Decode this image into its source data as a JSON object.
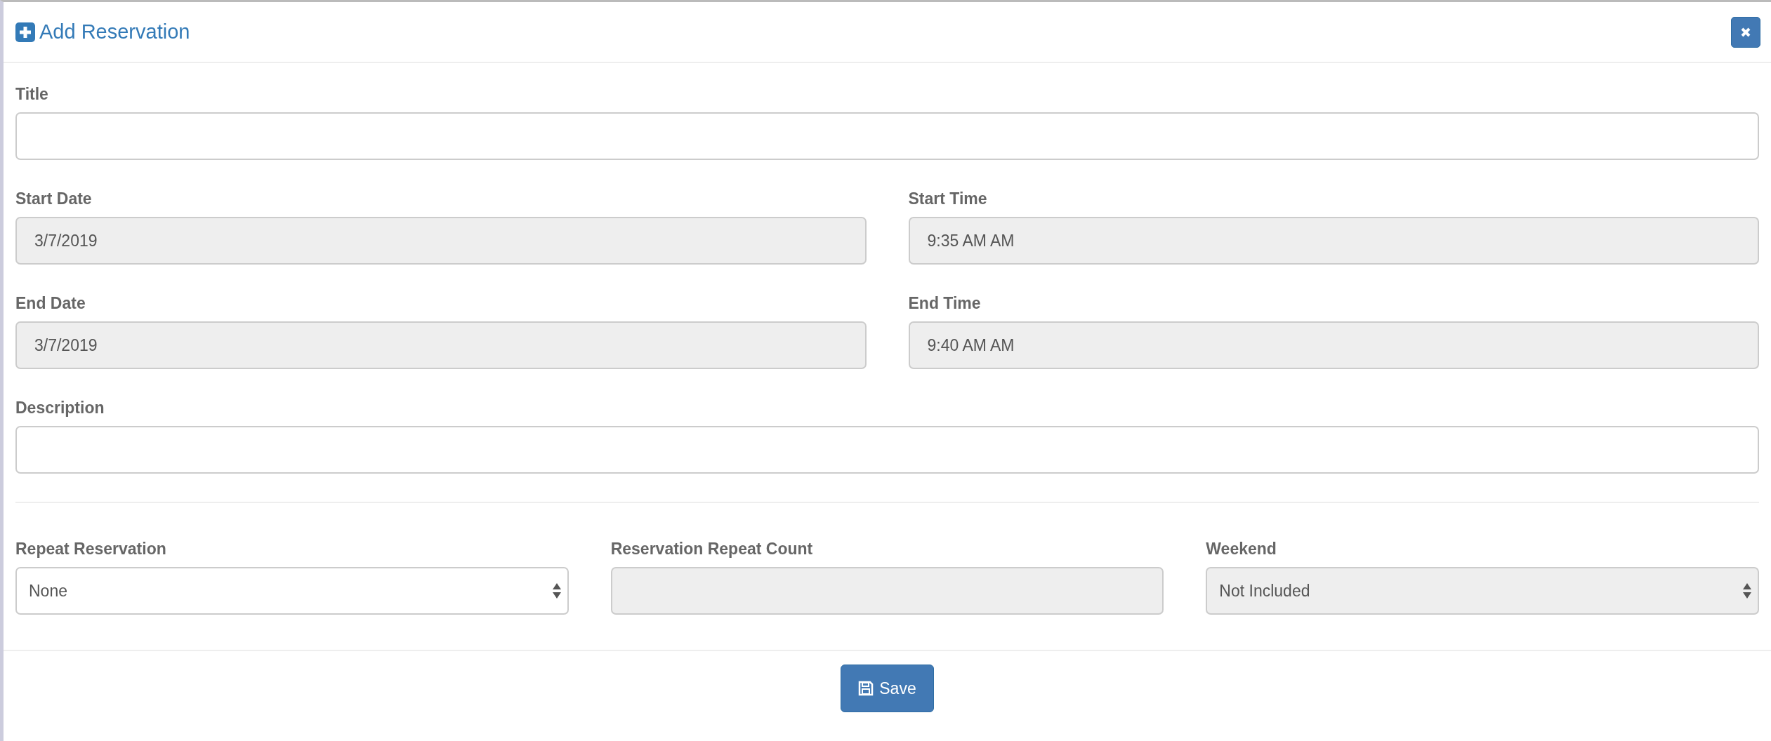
{
  "dialog": {
    "title": "Add Reservation"
  },
  "fields": [
    {
      "label": "Title",
      "kind": "text",
      "disabled": false
    },
    {
      "label": "Start Date",
      "kind": "text",
      "value": "3/7/2019",
      "disabled": true
    },
    {
      "label": "Start Time",
      "kind": "text",
      "value": "9:35 AM AM",
      "disabled": true
    },
    {
      "label": "End Date",
      "kind": "text",
      "value": "3/7/2019",
      "disabled": true
    },
    {
      "label": "End Time",
      "kind": "text",
      "value": "9:40 AM AM",
      "disabled": true
    },
    {
      "label": "Description",
      "kind": "text",
      "disabled": false
    }
  ],
  "repeat_fields": [
    {
      "label": "Repeat Reservation",
      "kind": "select",
      "value": "None",
      "disabled": false
    },
    {
      "label": "Reservation Repeat Count",
      "kind": "text",
      "disabled": true
    },
    {
      "label": "Weekend",
      "kind": "select",
      "value": "Not Included",
      "disabled": true
    }
  ],
  "footer": {
    "save_button": "Save"
  }
}
